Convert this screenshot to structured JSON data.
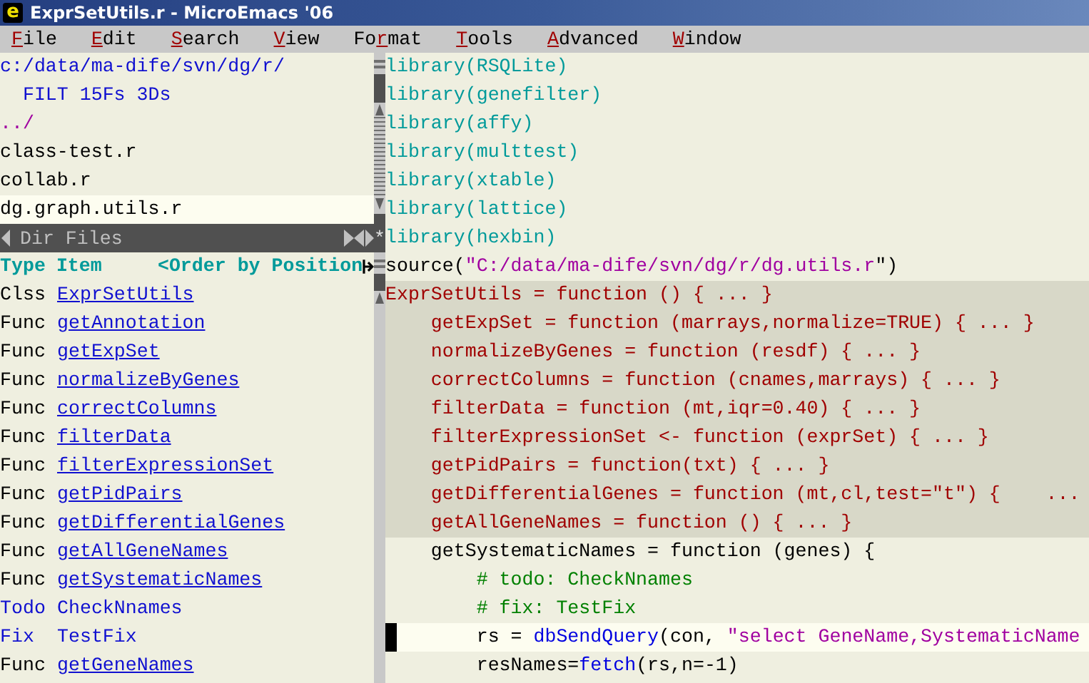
{
  "window": {
    "title": "ExprSetUtils.r - MicroEmacs '06",
    "icon_letter": "e"
  },
  "menu": [
    {
      "key": "F",
      "post": "ile"
    },
    {
      "key": "E",
      "post": "dit"
    },
    {
      "key": "S",
      "post": "earch"
    },
    {
      "key": "V",
      "post": "iew"
    },
    {
      "pre": "Fo",
      "key": "r",
      "post": "mat"
    },
    {
      "key": "T",
      "post": "ools"
    },
    {
      "key": "A",
      "post": "dvanced"
    },
    {
      "key": "W",
      "post": "indow"
    }
  ],
  "dir_pane": {
    "path": "c:/data/ma-dife/svn/dg/r/",
    "filter": "  FILT 15Fs 3Ds",
    "entries": [
      {
        "name": "../",
        "kind": "dir",
        "selected": false
      },
      {
        "name": "class-test.r",
        "kind": "file",
        "selected": false
      },
      {
        "name": "collab.r",
        "kind": "file",
        "selected": false
      },
      {
        "name": "dg.graph.utils.r",
        "kind": "file",
        "selected": true
      }
    ]
  },
  "mode_line": {
    "label": "Dir Files",
    "modified_flag": "*"
  },
  "item_list": {
    "columns": [
      "Type",
      "Item"
    ],
    "order": "<Order by Position",
    "items": [
      {
        "type": "Clss",
        "name": "ExprSetUtils",
        "kind": "link"
      },
      {
        "type": "Func",
        "name": "getAnnotation",
        "kind": "link"
      },
      {
        "type": "Func",
        "name": "getExpSet",
        "kind": "link"
      },
      {
        "type": "Func",
        "name": "normalizeByGenes",
        "kind": "link"
      },
      {
        "type": "Func",
        "name": "correctColumns",
        "kind": "link"
      },
      {
        "type": "Func",
        "name": "filterData",
        "kind": "link"
      },
      {
        "type": "Func",
        "name": "filterExpressionSet",
        "kind": "link"
      },
      {
        "type": "Func",
        "name": "getPidPairs",
        "kind": "link"
      },
      {
        "type": "Func",
        "name": "getDifferentialGenes",
        "kind": "link"
      },
      {
        "type": "Func",
        "name": "getAllGeneNames",
        "kind": "link"
      },
      {
        "type": "Func",
        "name": "getSystematicNames",
        "kind": "link"
      },
      {
        "type": "Todo",
        "name": "CheckNnames",
        "kind": "tag"
      },
      {
        "type": "Fix",
        "name": "TestFix",
        "kind": "tag"
      },
      {
        "type": "Func",
        "name": "getGeneNames",
        "kind": "link"
      }
    ]
  },
  "editor": {
    "lines": [
      {
        "kind": "normal",
        "segments": [
          {
            "text": "library(RSQLite)",
            "kind": "lib"
          }
        ]
      },
      {
        "kind": "normal",
        "segments": [
          {
            "text": "library(genefilter)",
            "kind": "lib"
          }
        ]
      },
      {
        "kind": "normal",
        "segments": [
          {
            "text": "library(affy)",
            "kind": "lib"
          }
        ]
      },
      {
        "kind": "normal",
        "segments": [
          {
            "text": "library(multtest)",
            "kind": "lib"
          }
        ]
      },
      {
        "kind": "normal",
        "segments": [
          {
            "text": "library(xtable)",
            "kind": "lib"
          }
        ]
      },
      {
        "kind": "normal",
        "segments": [
          {
            "text": "library(lattice)",
            "kind": "lib"
          }
        ]
      },
      {
        "kind": "normal",
        "segments": [
          {
            "text": "library(hexbin)",
            "kind": "lib"
          }
        ]
      },
      {
        "kind": "normal",
        "segments": [
          {
            "text": "source(",
            "kind": "plain"
          },
          {
            "text": "\"C:/data/ma-dife/svn/dg/r/dg.utils.r",
            "kind": "string"
          },
          {
            "text": "\")",
            "kind": "plain"
          }
        ]
      },
      {
        "kind": "folded",
        "segments": [
          {
            "text": "ExprSetUtils = function () { ... }",
            "kind": "fold"
          }
        ]
      },
      {
        "kind": "folded",
        "segments": [
          {
            "text": "    getExpSet = function (marrays,normalize=TRUE) { ... }",
            "kind": "fold"
          }
        ]
      },
      {
        "kind": "folded",
        "segments": [
          {
            "text": "    normalizeByGenes = function (resdf) { ... }",
            "kind": "fold"
          }
        ]
      },
      {
        "kind": "folded",
        "segments": [
          {
            "text": "    correctColumns = function (cnames,marrays) { ... }",
            "kind": "fold"
          }
        ]
      },
      {
        "kind": "folded",
        "segments": [
          {
            "text": "    filterData = function (mt,iqr=0.40) { ... }",
            "kind": "fold"
          }
        ]
      },
      {
        "kind": "folded",
        "segments": [
          {
            "text": "    filterExpressionSet <- function (exprSet) { ... }",
            "kind": "fold"
          }
        ]
      },
      {
        "kind": "folded",
        "segments": [
          {
            "text": "    getPidPairs = function(txt) { ... }",
            "kind": "fold"
          }
        ]
      },
      {
        "kind": "folded",
        "segments": [
          {
            "text": "    getDifferentialGenes = function (mt,cl,test=\"t\") {    ...",
            "kind": "fold"
          }
        ]
      },
      {
        "kind": "folded",
        "segments": [
          {
            "text": "    getAllGeneNames = function () { ... }",
            "kind": "fold"
          }
        ]
      },
      {
        "kind": "normal",
        "segments": [
          {
            "text": "    getSystematicNames = function (genes) {",
            "kind": "plain"
          }
        ]
      },
      {
        "kind": "normal",
        "segments": [
          {
            "text": "        # todo: CheckNnames",
            "kind": "comment"
          }
        ]
      },
      {
        "kind": "normal",
        "segments": [
          {
            "text": "        # fix: TestFix",
            "kind": "comment"
          }
        ]
      },
      {
        "kind": "current",
        "segments": [
          {
            "text": "        rs = ",
            "kind": "plain"
          },
          {
            "text": "dbSendQuery",
            "kind": "call"
          },
          {
            "text": "(con, ",
            "kind": "plain"
          },
          {
            "text": "\"select GeneName,SystematicName",
            "kind": "string"
          }
        ]
      },
      {
        "kind": "normal",
        "segments": [
          {
            "text": "        resNames=",
            "kind": "plain"
          },
          {
            "text": "fetch",
            "kind": "call"
          },
          {
            "text": "(rs,n=-1)",
            "kind": "plain"
          }
        ]
      }
    ]
  }
}
